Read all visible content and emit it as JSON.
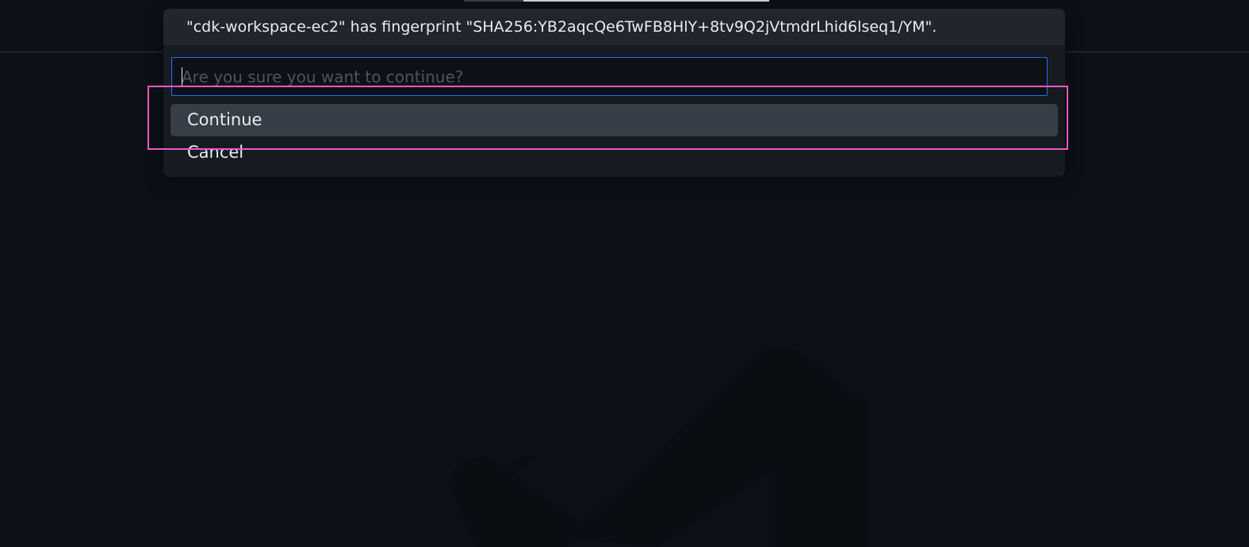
{
  "dialog": {
    "title": "\"cdk-workspace-ec2\" has fingerprint \"SHA256:YB2aqcQe6TwFB8HlY+8tv9Q2jVtmdrLhid6lseq1/YM\".",
    "input": {
      "value": "",
      "placeholder": "Are you sure you want to continue?"
    },
    "options": [
      {
        "label": "Continue",
        "selected": true
      },
      {
        "label": "Cancel",
        "selected": false
      }
    ]
  },
  "colors": {
    "background": "#0d1117",
    "panel": "#161b22",
    "title_bar": "#21262d",
    "input_border": "#1f6feb",
    "selected_item": "#383e47",
    "highlight": "#f055c8"
  }
}
